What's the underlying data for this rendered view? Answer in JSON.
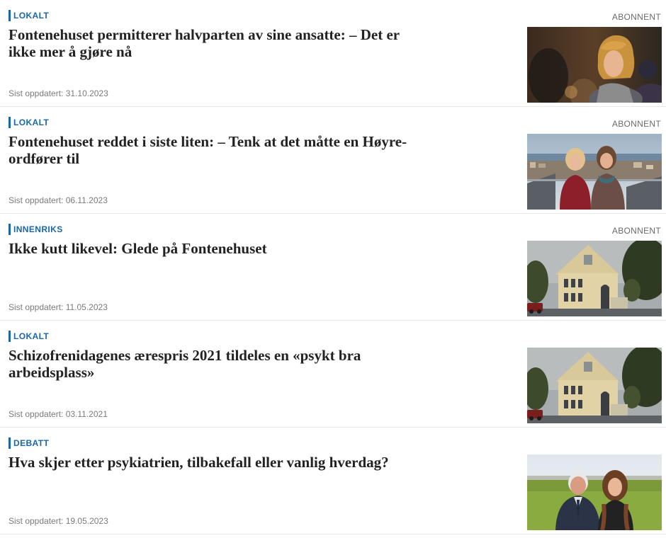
{
  "articles": [
    {
      "category": "LOKALT",
      "premium": "ABONNENT",
      "title": "Fontenehuset permitterer halvparten av sine ansatte: – Det er ikke mer å gjøre nå",
      "date": "Sist oppdatert: 31.10.2023",
      "image": "woman-curly-hair-photo"
    },
    {
      "category": "LOKALT",
      "premium": "ABONNENT",
      "title": "Fontenehuset reddet i siste liten: – Tenk at det måtte en Høyre-ordfører til",
      "date": "Sist oppdatert: 06.11.2023",
      "image": "two-women-city-view-photo"
    },
    {
      "category": "INNENRIKS",
      "premium": "ABONNENT",
      "title": "Ikke kutt likevel: Glede på Fontenehuset",
      "date": "Sist oppdatert: 11.05.2023",
      "image": "yellow-house-photo"
    },
    {
      "category": "LOKALT",
      "premium": "",
      "title": "Schizofrenidagenes ærespris 2021 tildeles en «psykt bra arbeidsplass»",
      "date": "Sist oppdatert: 03.11.2021",
      "image": "yellow-house-photo"
    },
    {
      "category": "DEBATT",
      "premium": "",
      "title": "Hva skjer etter psykiatrien, tilbakefall eller vanlig hverdag?",
      "date": "Sist oppdatert: 19.05.2023",
      "image": "man-and-woman-field-photo"
    }
  ],
  "colors": {
    "category": "#1a66a8",
    "title": "#222222",
    "meta": "#7a7a7a"
  }
}
